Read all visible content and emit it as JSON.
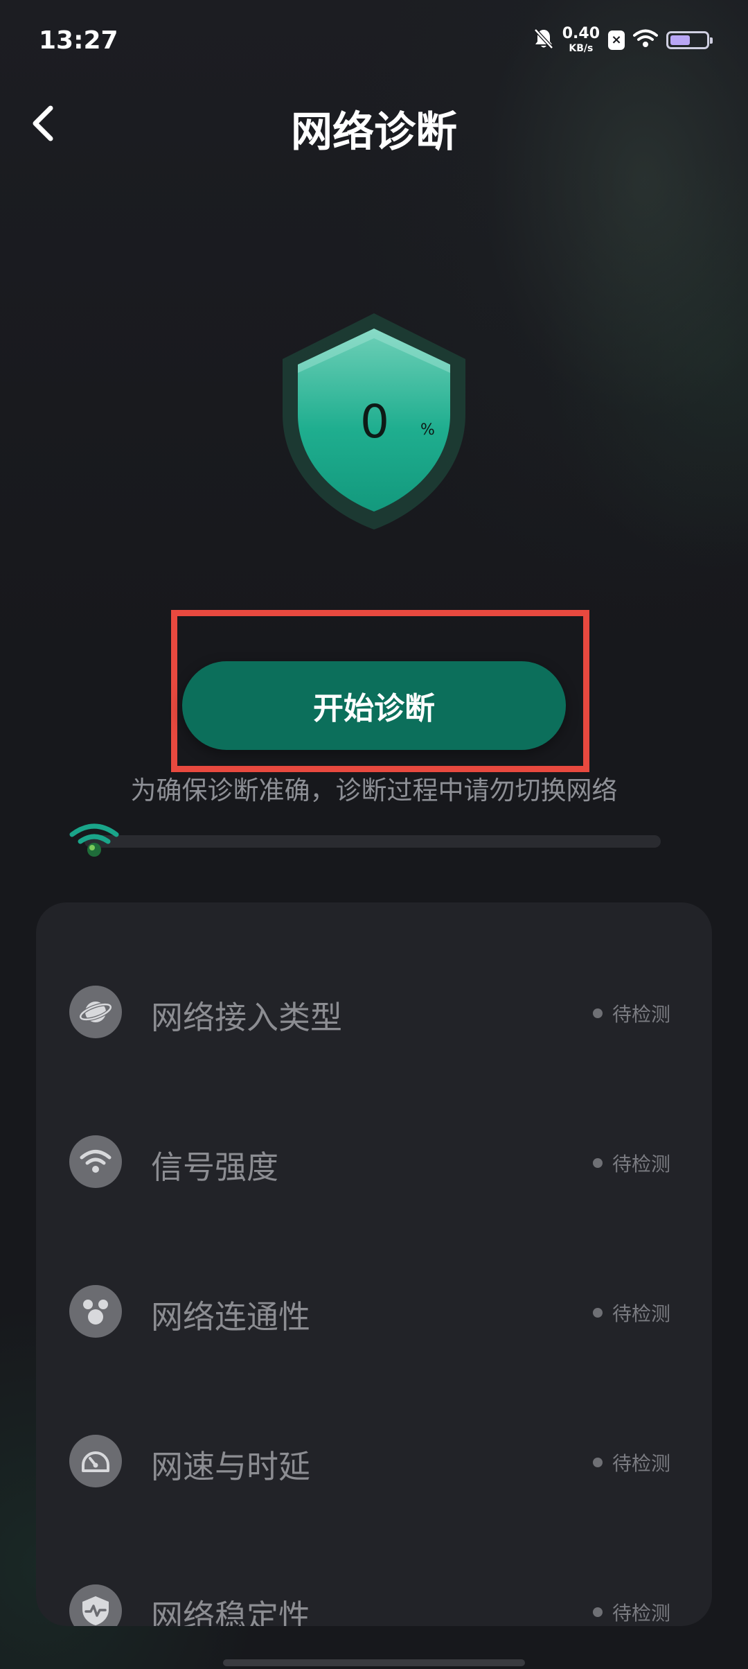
{
  "status_bar": {
    "time": "13:27",
    "net_speed_value": "0.40",
    "net_speed_unit": "KB/s",
    "x_badge": "×",
    "battery_level": 0.55,
    "icons": [
      "mute-bell-icon",
      "wifi-icon",
      "battery-icon"
    ]
  },
  "header": {
    "back_icon": "chevron-left-icon",
    "title": "网络诊断"
  },
  "shield": {
    "value": "0",
    "unit": "%"
  },
  "actions": {
    "start_label": "开始诊断",
    "hint": "为确保诊断准确，诊断过程中请勿切换网络"
  },
  "progress": {
    "fraction": 0.0,
    "icon": "wifi-globe-icon"
  },
  "diagnostics": {
    "items": [
      {
        "label": "网络接入类型",
        "status": "待检测",
        "icon": "planet-icon"
      },
      {
        "label": "信号强度",
        "status": "待检测",
        "icon": "wifi-icon"
      },
      {
        "label": "网络连通性",
        "status": "待检测",
        "icon": "nodes-icon"
      },
      {
        "label": "网速与时延",
        "status": "待检测",
        "icon": "speedometer-icon"
      },
      {
        "label": "网络稳定性",
        "status": "待检测",
        "icon": "shield-pulse-icon"
      }
    ]
  },
  "colors": {
    "accent": "#0c6f5b",
    "shield": "#1aa58a",
    "highlight": "#e8493f",
    "card": "#222328"
  }
}
